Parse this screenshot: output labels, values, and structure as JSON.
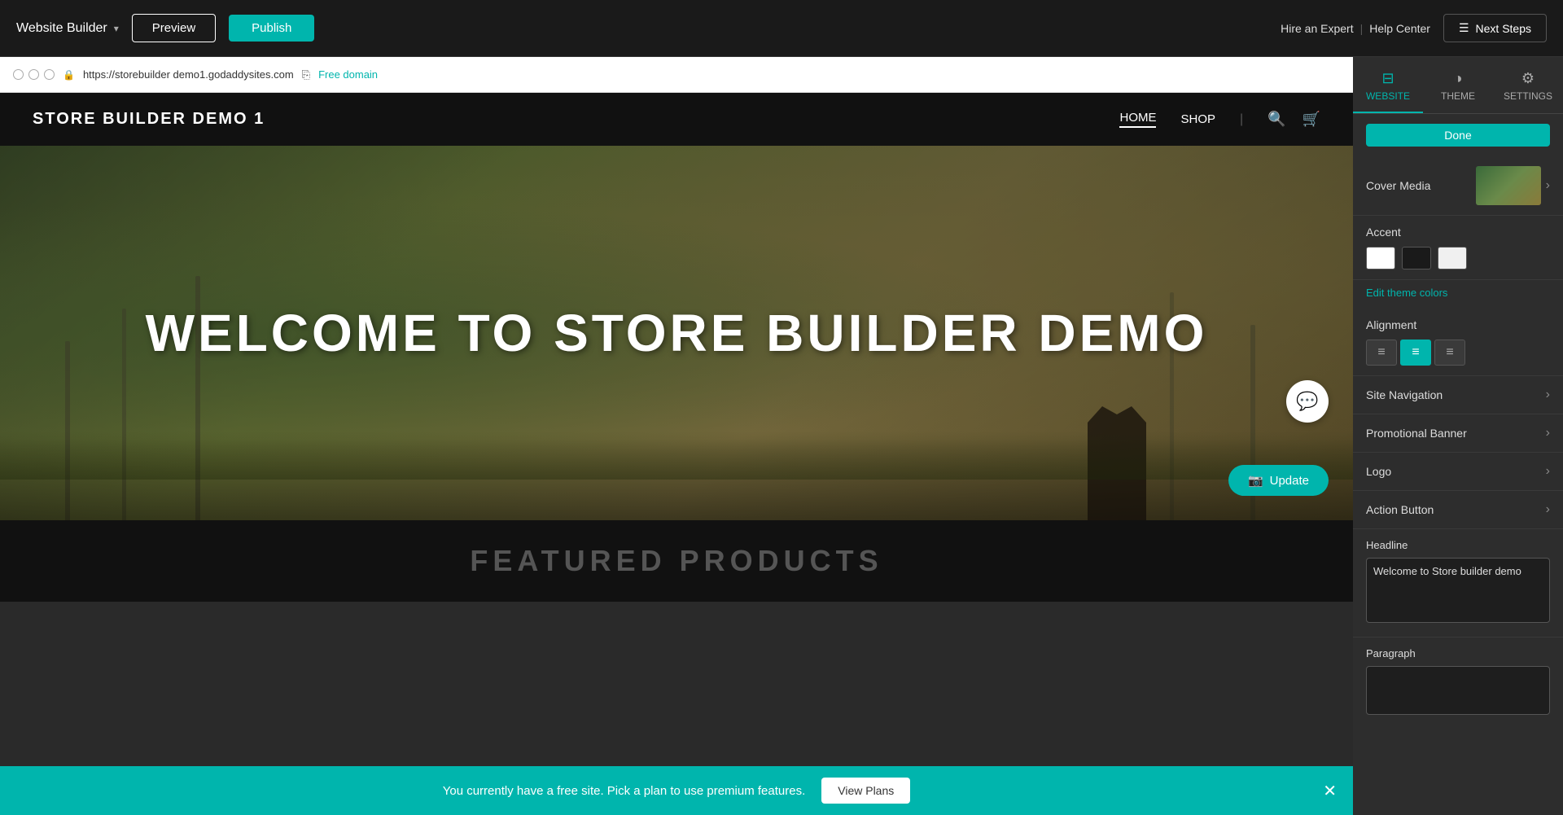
{
  "topbar": {
    "brand_label": "Website Builder",
    "preview_label": "Preview",
    "publish_label": "Publish",
    "hire_expert": "Hire an Expert",
    "help_center": "Help Center",
    "next_steps_label": "Next Steps"
  },
  "browser": {
    "url": "https://storebuilder demo1.godaddysites.com",
    "domain_label": "Free domain"
  },
  "site": {
    "logo": "STORE BUILDER DEMO 1",
    "nav_home": "HOME",
    "nav_shop": "SHOP",
    "hero_title": "WELCOME TO STORE BUILDER DEMO",
    "update_btn": "Update",
    "featured_title": "FEATURED PRODUCTS"
  },
  "bottom_banner": {
    "text": "You currently have a free site. Pick a plan to use premium features.",
    "view_plans": "View Plans"
  },
  "panel": {
    "tabs": [
      {
        "label": "WEBSITE",
        "icon": "⊟"
      },
      {
        "label": "THEME",
        "icon": "◑"
      },
      {
        "label": "SETTINGS",
        "icon": "⚙"
      }
    ],
    "done_label": "Done",
    "cover_media_label": "Cover Media",
    "accent_label": "Accent",
    "edit_theme_colors": "Edit theme colors",
    "alignment_label": "Alignment",
    "site_navigation_label": "Site Navigation",
    "promotional_banner_label": "Promotional Banner",
    "logo_label": "Logo",
    "action_button_label": "Action Button",
    "headline_label": "Headline",
    "headline_value": "Welcome to Store builder demo",
    "paragraph_label": "Paragraph",
    "paragraph_value": "",
    "accent_colors": [
      "#ffffff",
      "#1a1a1a",
      "#f0f0f0"
    ],
    "alignment_options": [
      "left",
      "center",
      "right"
    ]
  }
}
